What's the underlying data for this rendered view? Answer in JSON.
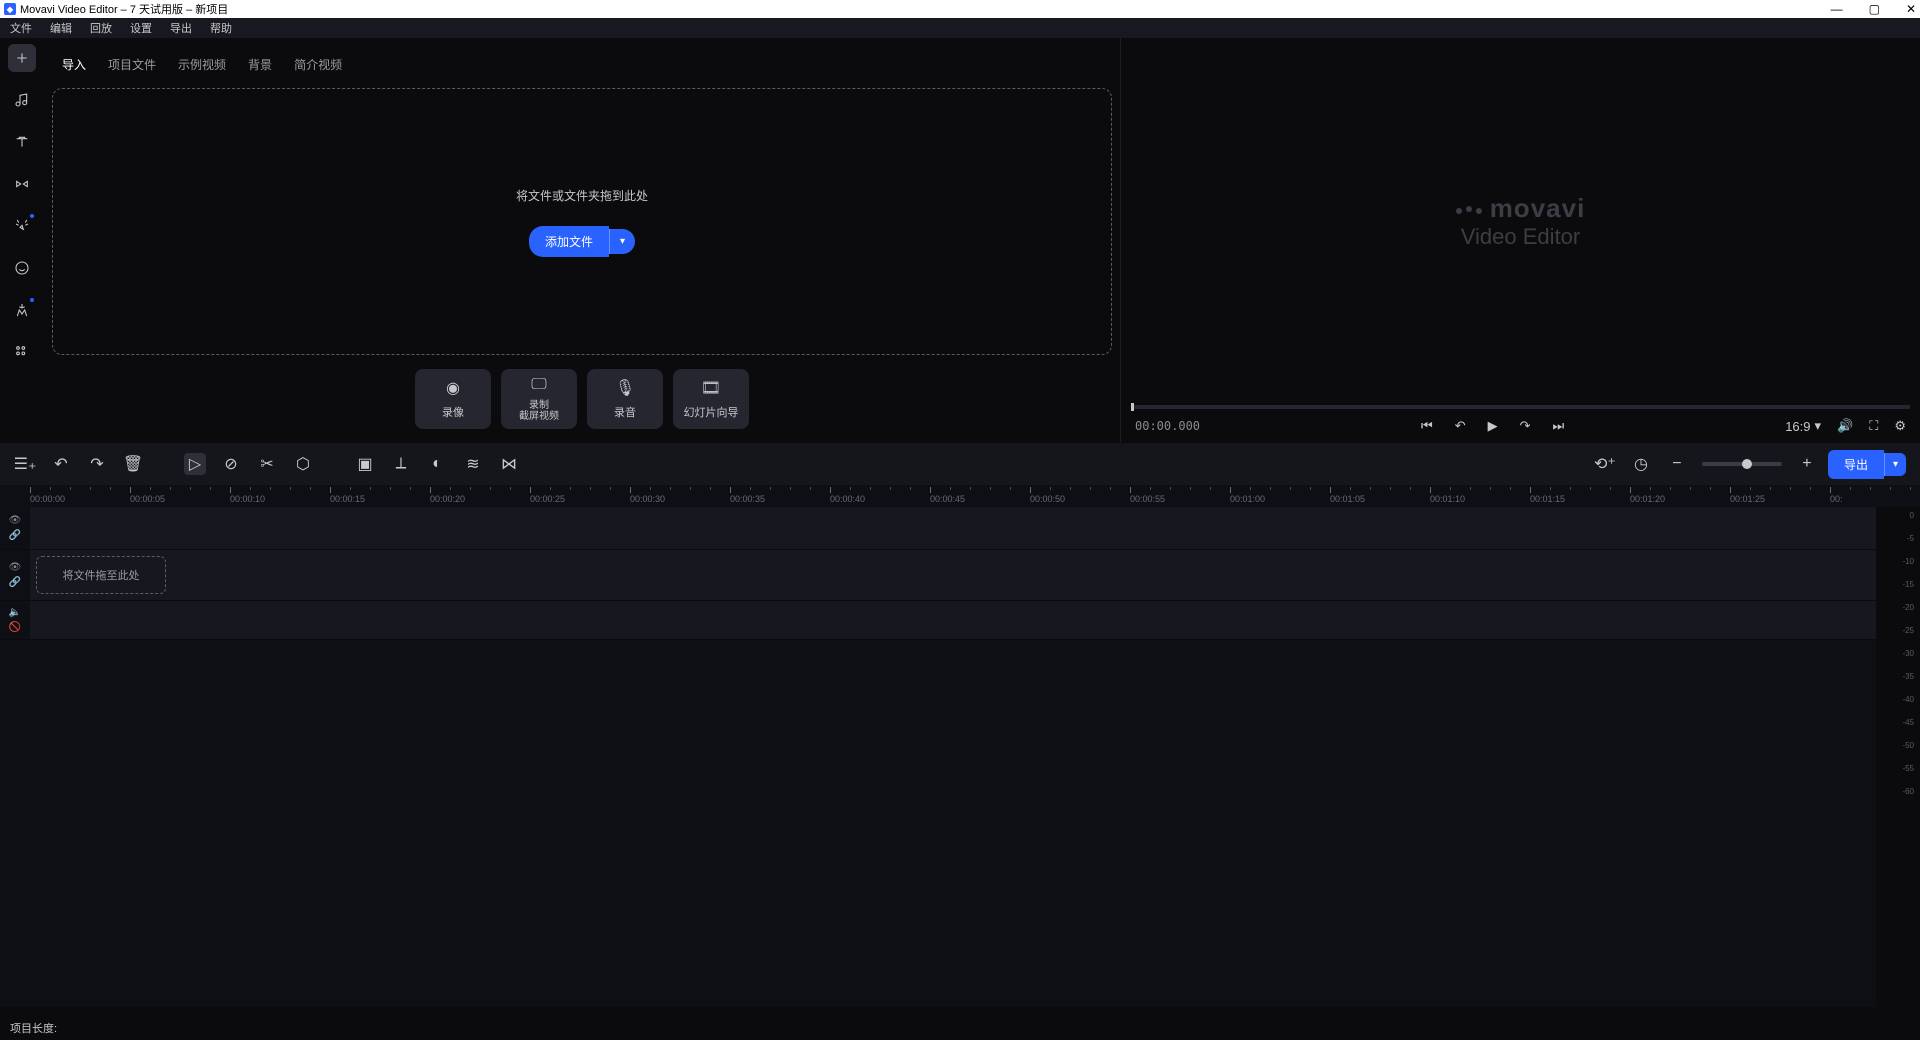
{
  "titlebar": {
    "title": "Movavi Video Editor – 7 天试用版 – 新项目"
  },
  "menubar": [
    "文件",
    "编辑",
    "回放",
    "设置",
    "导出",
    "帮助"
  ],
  "import_tabs": [
    "导入",
    "项目文件",
    "示例视频",
    "背景",
    "简介视频"
  ],
  "dropzone_hint": "将文件或文件夹拖到此处",
  "add_file_label": "添加文件",
  "capture_buttons": [
    {
      "label": "录像",
      "sub": ""
    },
    {
      "label": "录制",
      "sub": "截屏视频"
    },
    {
      "label": "录音",
      "sub": ""
    },
    {
      "label": "幻灯片向导",
      "sub": ""
    }
  ],
  "preview": {
    "brand1": "movavi",
    "brand2": "Video Editor",
    "time": "00:00.000",
    "aspect": "16:9"
  },
  "export_label": "导出",
  "ruler": [
    "00:00:00",
    "00:00:05",
    "00:00:10",
    "00:00:15",
    "00:00:20",
    "00:00:25",
    "00:00:30",
    "00:00:35",
    "00:00:40",
    "00:00:45",
    "00:00:50",
    "00:00:55",
    "00:01:00",
    "00:01:05",
    "00:01:10",
    "00:01:15",
    "00:01:20",
    "00:01:25",
    "00:"
  ],
  "drop_clip_hint": "将文件拖至此处",
  "meter_labels": [
    "0",
    "-5",
    "-10",
    "-15",
    "-20",
    "-25",
    "-30",
    "-35",
    "-40",
    "-45",
    "-50",
    "-55",
    "-60"
  ],
  "status_label": "项目长度:"
}
